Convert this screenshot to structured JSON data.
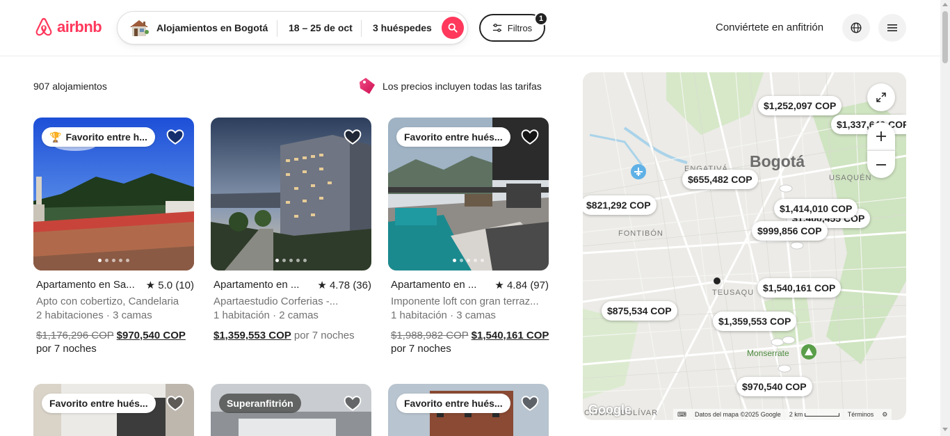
{
  "header": {
    "logo_text": "airbnb",
    "search": {
      "location": "Alojamientos en Bogotá",
      "dates": "18 – 25 de oct",
      "guests": "3 huéspedes"
    },
    "filters_label": "Filtros",
    "filters_count": "1",
    "host_label": "Conviértete en anfitrión",
    "brand_color": "#ff385c"
  },
  "listings": {
    "count": "907 alojamientos",
    "prices_note": "Los precios incluyen todas las tarifas",
    "cards": [
      {
        "badge": "Favorito entre h...",
        "title": "Apartamento en Sa...",
        "rating": "5.0 (10)",
        "subtitle": "Apto con cobertizo, Candelaria",
        "details": "2 habitaciones · 3 camas",
        "price_old": "$1,176,296 COP",
        "price": "$970,540 COP",
        "price_suffix": "",
        "per": "por 7 noches"
      },
      {
        "badge": "",
        "title": "Apartamento en ...",
        "rating": "4.78 (36)",
        "subtitle": "Apartaestudio Corferias -...",
        "details": "1 habitación · 2 camas",
        "price_old": "",
        "price": "$1,359,553 COP",
        "price_suffix": "por 7 noches",
        "per": ""
      },
      {
        "badge": "Favorito entre hués...",
        "title": "Apartamento en ...",
        "rating": "4.84 (97)",
        "subtitle": "Imponente loft con gran terraz...",
        "details": "1 habitación · 3 camas",
        "price_old": "$1,988,982 COP",
        "price": "$1,540,161 COP",
        "price_suffix": "",
        "per": "por 7 noches"
      },
      {
        "badge": "Favorito entre hués..."
      },
      {
        "badge": "Superanfitrión"
      },
      {
        "badge": "Favorito entre hués..."
      }
    ]
  },
  "map": {
    "city": "Bogotá",
    "labels": [
      "ENGATIVÁ",
      "USAQUÉN",
      "FONTIBÓN",
      "TEUSAQU",
      "Monserrate",
      "CIUDAD BOLÍVAR"
    ],
    "pins": [
      "$1,252,097 COP",
      "$1,337,640 COP",
      "$655,482 COP",
      "$821,292 COP",
      "$1,414,010 COP",
      "$1,400,455 COP",
      "$999,856 COP",
      "$1,540,161 COP",
      "$875,534 COP",
      "$1,359,553 COP",
      "$970,540 COP"
    ],
    "google": "Google",
    "footer": {
      "data": "Datos del mapa ©2025 Google",
      "scale": "2 km",
      "terms": "Términos"
    }
  }
}
